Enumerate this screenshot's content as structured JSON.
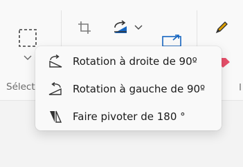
{
  "toolbar": {
    "selection_group_label": "Sélection"
  },
  "rotate_menu": {
    "items": [
      {
        "label": "Rotation à droite de 90º",
        "icon": "rotate-right-icon"
      },
      {
        "label": "Rotation à gauche de 90º",
        "icon": "rotate-left-icon"
      },
      {
        "label": "Faire pivoter de 180 °",
        "icon": "flip-180-icon"
      }
    ]
  },
  "colors": {
    "accent_blue": "#1565c0",
    "pencil_yellow": "#e0a100",
    "eraser_pink": "#e84f6a"
  }
}
